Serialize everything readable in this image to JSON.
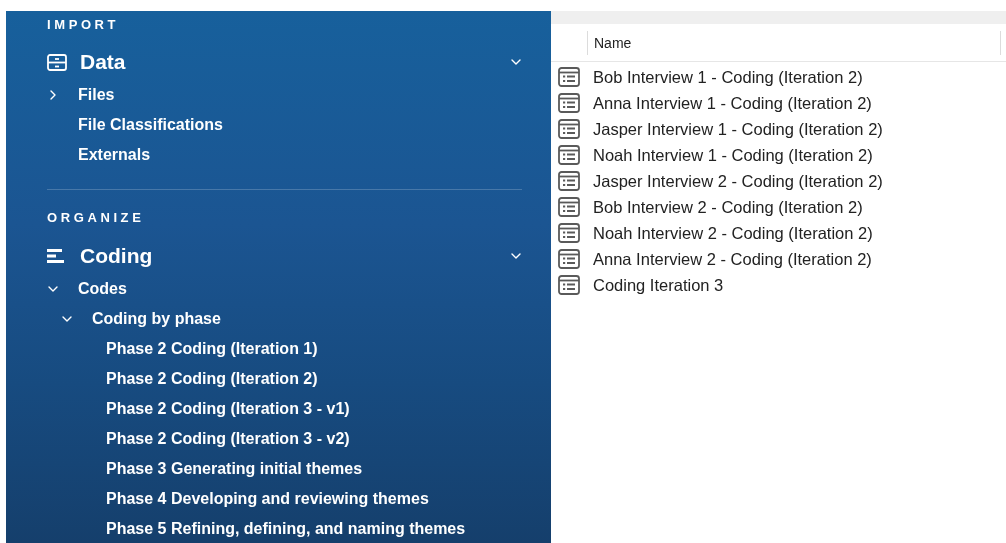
{
  "sidebar": {
    "sections": [
      {
        "heading": "IMPORT",
        "group": {
          "title": "Data",
          "kind": "data",
          "expanded": true,
          "items": [
            {
              "label": "Files",
              "expanded": false
            },
            {
              "label": "File Classifications"
            },
            {
              "label": "Externals"
            }
          ]
        }
      },
      {
        "heading": "ORGANIZE",
        "group": {
          "title": "Coding",
          "kind": "coding",
          "expanded": true,
          "items": [
            {
              "label": "Codes",
              "expanded": true,
              "children": [
                {
                  "label": "Coding by phase",
                  "expanded": true,
                  "children": [
                    {
                      "label": "Phase 2 Coding (Iteration 1)"
                    },
                    {
                      "label": "Phase 2 Coding (Iteration 2)"
                    },
                    {
                      "label": "Phase 2 Coding (Iteration 3 - v1)"
                    },
                    {
                      "label": "Phase 2 Coding (Iteration 3 - v2)"
                    },
                    {
                      "label": "Phase 3 Generating initial themes"
                    },
                    {
                      "label": "Phase 4 Developing and reviewing themes"
                    },
                    {
                      "label": "Phase 5 Refining, defining, and naming themes"
                    }
                  ]
                }
              ]
            }
          ]
        }
      }
    ]
  },
  "list": {
    "columns": [
      "Name"
    ],
    "rows": [
      {
        "name": "Bob Interview 1 - Coding (Iteration 2)"
      },
      {
        "name": "Anna Interview 1 - Coding (Iteration 2)"
      },
      {
        "name": "Jasper Interview 1 - Coding (Iteration 2)"
      },
      {
        "name": "Noah Interview 1 - Coding (Iteration 2)"
      },
      {
        "name": "Jasper Interview 2 - Coding (Iteration 2)"
      },
      {
        "name": "Bob Interview 2 - Coding (Iteration 2)"
      },
      {
        "name": "Noah Interview 2 - Coding (Iteration 2)"
      },
      {
        "name": "Anna Interview 2 - Coding (Iteration 2)"
      },
      {
        "name": "Coding Iteration 3"
      }
    ]
  }
}
